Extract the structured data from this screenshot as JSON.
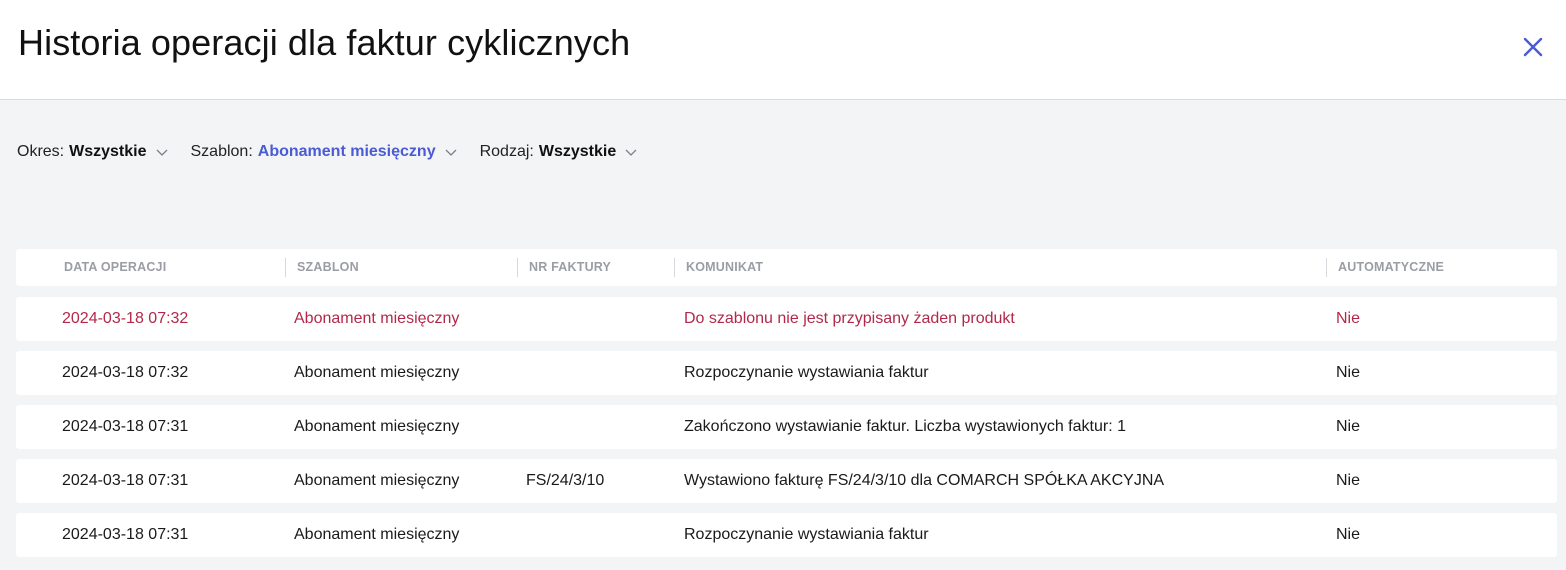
{
  "title": "Historia operacji dla faktur cyklicznych",
  "close_icon": "close-icon",
  "colors": {
    "accent": "#4a5bd4",
    "error": "#b3284a"
  },
  "filters": [
    {
      "label": "Okres:",
      "value": "Wszystkie"
    },
    {
      "label": "Szablon:",
      "value": "Abonament miesięczny"
    },
    {
      "label": "Rodzaj:",
      "value": "Wszystkie"
    }
  ],
  "table": {
    "columns": [
      "DATA OPERACJI",
      "SZABLON",
      "NR FAKTURY",
      "KOMUNIKAT",
      "AUTOMATYCZNE"
    ],
    "rows": [
      {
        "date": "2024-03-18 07:32",
        "template": "Abonament miesięczny",
        "invoice": "",
        "message": "Do szablonu nie jest przypisany żaden produkt",
        "auto": "Nie",
        "status": "error"
      },
      {
        "date": "2024-03-18 07:32",
        "template": "Abonament miesięczny",
        "invoice": "",
        "message": "Rozpoczynanie wystawiania faktur",
        "auto": "Nie",
        "status": "normal"
      },
      {
        "date": "2024-03-18 07:31",
        "template": "Abonament miesięczny",
        "invoice": "",
        "message": "Zakończono wystawianie faktur. Liczba wystawionych faktur: 1",
        "auto": "Nie",
        "status": "normal"
      },
      {
        "date": "2024-03-18 07:31",
        "template": "Abonament miesięczny",
        "invoice": "FS/24/3/10",
        "message": "Wystawiono fakturę FS/24/3/10 dla COMARCH SPÓŁKA AKCYJNA",
        "auto": "Nie",
        "status": "normal"
      },
      {
        "date": "2024-03-18 07:31",
        "template": "Abonament miesięczny",
        "invoice": "",
        "message": "Rozpoczynanie wystawiania faktur",
        "auto": "Nie",
        "status": "normal"
      }
    ]
  }
}
